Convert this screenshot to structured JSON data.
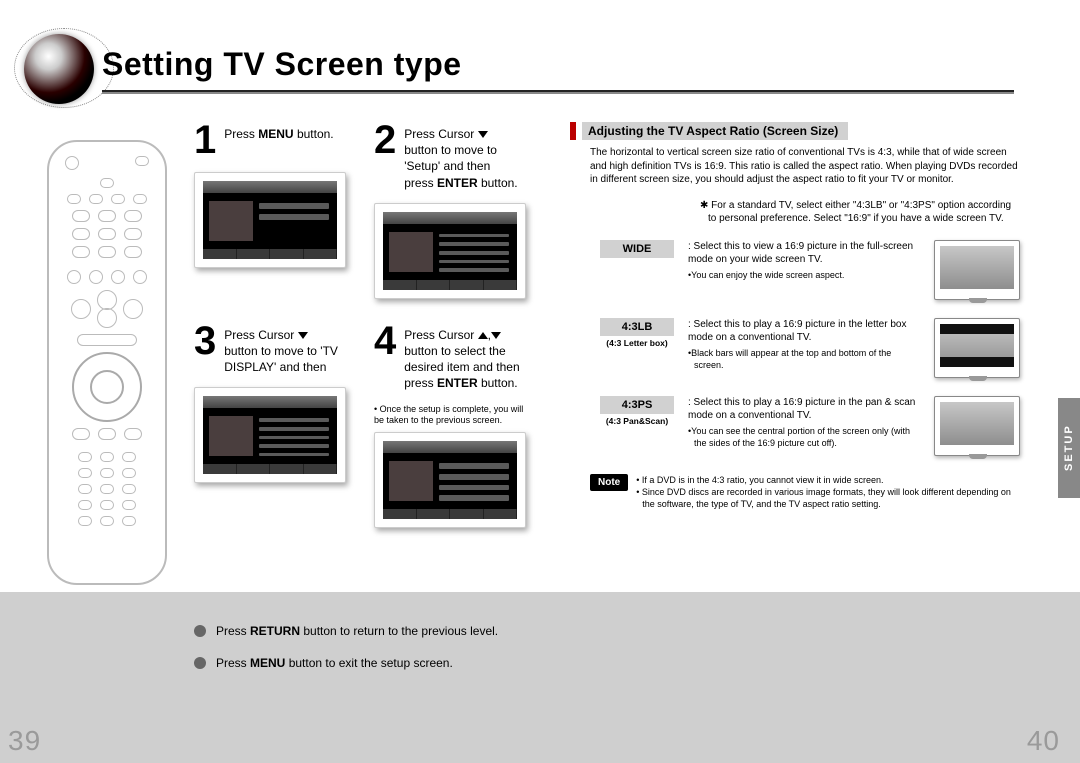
{
  "title": "Setting TV Screen type",
  "side_tab": "SETUP",
  "page_left": "39",
  "page_right": "40",
  "steps": {
    "s1": {
      "num": "1",
      "pre": "Press ",
      "bold": "MENU",
      "post": " button."
    },
    "s2": {
      "num": "2",
      "l1": "Press Cursor ",
      "l2": "button to move to",
      "l3": "'Setup' and then",
      "l4_pre": "press ",
      "l4_bold": "ENTER",
      "l4_post": " button."
    },
    "s3": {
      "num": "3",
      "l1": "Press Cursor ",
      "l2": "button to move to 'TV",
      "l3": "DISPLAY' and then"
    },
    "s4": {
      "num": "4",
      "l1": "Press Cursor ",
      "l2": "button to select the",
      "l3": "desired item and then",
      "l4_pre": "press ",
      "l4_bold": "ENTER",
      "l4_post": " button."
    },
    "s4_note": "• Once the setup is complete, you will be taken to the previous screen."
  },
  "right": {
    "section_title": "Adjusting the TV Aspect Ratio (Screen Size)",
    "intro": "The horizontal to vertical screen size ratio of conventional TVs is 4:3, while that of wide screen and high definition TVs is 16:9. This ratio is called the aspect ratio. When playing DVDs recorded in different screen size, you should adjust the aspect ratio to fit your TV or monitor.",
    "star": "✱ For a standard TV, select either \"4:3LB\" or \"4:3PS\" option according to personal preference. Select \"16:9\" if you have a wide screen TV.",
    "wide": {
      "label": "WIDE",
      "text": ": Select this to view a 16:9 picture in the full-screen mode on your wide screen TV.",
      "bullet": "•You can enjoy the wide screen aspect."
    },
    "lb": {
      "label": "4:3LB",
      "sub": "(4:3 Letter box)",
      "text": ": Select this to play a 16:9 picture in the letter box mode on a conventional TV.",
      "bullet": "•Black bars will appear at the top and bottom of the screen."
    },
    "ps": {
      "label": "4:3PS",
      "sub": "(4:3 Pan&Scan)",
      "text": ": Select this to play a 16:9 picture in the pan & scan mode on a conventional TV.",
      "bullet": "•You can see the central portion of the screen only (with the sides of the 16:9 picture cut off)."
    },
    "note_label": "Note",
    "note1": "• If a DVD is in the 4:3 ratio, you cannot view it in wide screen.",
    "note2": "• Since DVD discs are recorded in various image formats, they will look different depending on the software, the type of TV, and the TV aspect ratio setting."
  },
  "footer": {
    "b1_pre": "Press ",
    "b1_bold": "RETURN",
    "b1_post": " button to return to the previous level.",
    "b2_pre": "Press ",
    "b2_bold": "MENU",
    "b2_post": " button to exit the setup screen."
  }
}
